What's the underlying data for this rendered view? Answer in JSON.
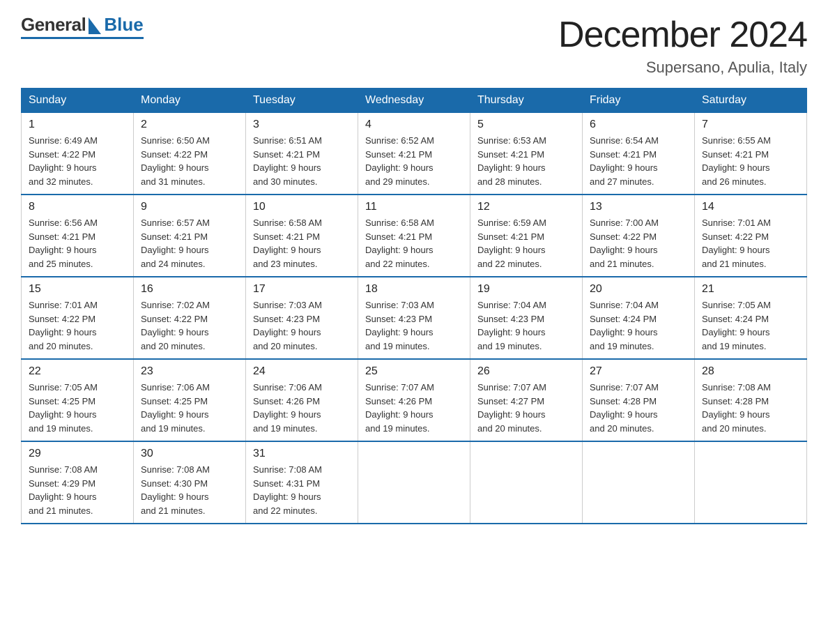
{
  "header": {
    "logo_general": "General",
    "logo_blue": "Blue",
    "month_title": "December 2024",
    "location": "Supersano, Apulia, Italy"
  },
  "days_of_week": [
    "Sunday",
    "Monday",
    "Tuesday",
    "Wednesday",
    "Thursday",
    "Friday",
    "Saturday"
  ],
  "weeks": [
    [
      {
        "day": "1",
        "sunrise": "6:49 AM",
        "sunset": "4:22 PM",
        "daylight": "9 hours and 32 minutes."
      },
      {
        "day": "2",
        "sunrise": "6:50 AM",
        "sunset": "4:22 PM",
        "daylight": "9 hours and 31 minutes."
      },
      {
        "day": "3",
        "sunrise": "6:51 AM",
        "sunset": "4:21 PM",
        "daylight": "9 hours and 30 minutes."
      },
      {
        "day": "4",
        "sunrise": "6:52 AM",
        "sunset": "4:21 PM",
        "daylight": "9 hours and 29 minutes."
      },
      {
        "day": "5",
        "sunrise": "6:53 AM",
        "sunset": "4:21 PM",
        "daylight": "9 hours and 28 minutes."
      },
      {
        "day": "6",
        "sunrise": "6:54 AM",
        "sunset": "4:21 PM",
        "daylight": "9 hours and 27 minutes."
      },
      {
        "day": "7",
        "sunrise": "6:55 AM",
        "sunset": "4:21 PM",
        "daylight": "9 hours and 26 minutes."
      }
    ],
    [
      {
        "day": "8",
        "sunrise": "6:56 AM",
        "sunset": "4:21 PM",
        "daylight": "9 hours and 25 minutes."
      },
      {
        "day": "9",
        "sunrise": "6:57 AM",
        "sunset": "4:21 PM",
        "daylight": "9 hours and 24 minutes."
      },
      {
        "day": "10",
        "sunrise": "6:58 AM",
        "sunset": "4:21 PM",
        "daylight": "9 hours and 23 minutes."
      },
      {
        "day": "11",
        "sunrise": "6:58 AM",
        "sunset": "4:21 PM",
        "daylight": "9 hours and 22 minutes."
      },
      {
        "day": "12",
        "sunrise": "6:59 AM",
        "sunset": "4:21 PM",
        "daylight": "9 hours and 22 minutes."
      },
      {
        "day": "13",
        "sunrise": "7:00 AM",
        "sunset": "4:22 PM",
        "daylight": "9 hours and 21 minutes."
      },
      {
        "day": "14",
        "sunrise": "7:01 AM",
        "sunset": "4:22 PM",
        "daylight": "9 hours and 21 minutes."
      }
    ],
    [
      {
        "day": "15",
        "sunrise": "7:01 AM",
        "sunset": "4:22 PM",
        "daylight": "9 hours and 20 minutes."
      },
      {
        "day": "16",
        "sunrise": "7:02 AM",
        "sunset": "4:22 PM",
        "daylight": "9 hours and 20 minutes."
      },
      {
        "day": "17",
        "sunrise": "7:03 AM",
        "sunset": "4:23 PM",
        "daylight": "9 hours and 20 minutes."
      },
      {
        "day": "18",
        "sunrise": "7:03 AM",
        "sunset": "4:23 PM",
        "daylight": "9 hours and 19 minutes."
      },
      {
        "day": "19",
        "sunrise": "7:04 AM",
        "sunset": "4:23 PM",
        "daylight": "9 hours and 19 minutes."
      },
      {
        "day": "20",
        "sunrise": "7:04 AM",
        "sunset": "4:24 PM",
        "daylight": "9 hours and 19 minutes."
      },
      {
        "day": "21",
        "sunrise": "7:05 AM",
        "sunset": "4:24 PM",
        "daylight": "9 hours and 19 minutes."
      }
    ],
    [
      {
        "day": "22",
        "sunrise": "7:05 AM",
        "sunset": "4:25 PM",
        "daylight": "9 hours and 19 minutes."
      },
      {
        "day": "23",
        "sunrise": "7:06 AM",
        "sunset": "4:25 PM",
        "daylight": "9 hours and 19 minutes."
      },
      {
        "day": "24",
        "sunrise": "7:06 AM",
        "sunset": "4:26 PM",
        "daylight": "9 hours and 19 minutes."
      },
      {
        "day": "25",
        "sunrise": "7:07 AM",
        "sunset": "4:26 PM",
        "daylight": "9 hours and 19 minutes."
      },
      {
        "day": "26",
        "sunrise": "7:07 AM",
        "sunset": "4:27 PM",
        "daylight": "9 hours and 20 minutes."
      },
      {
        "day": "27",
        "sunrise": "7:07 AM",
        "sunset": "4:28 PM",
        "daylight": "9 hours and 20 minutes."
      },
      {
        "day": "28",
        "sunrise": "7:08 AM",
        "sunset": "4:28 PM",
        "daylight": "9 hours and 20 minutes."
      }
    ],
    [
      {
        "day": "29",
        "sunrise": "7:08 AM",
        "sunset": "4:29 PM",
        "daylight": "9 hours and 21 minutes."
      },
      {
        "day": "30",
        "sunrise": "7:08 AM",
        "sunset": "4:30 PM",
        "daylight": "9 hours and 21 minutes."
      },
      {
        "day": "31",
        "sunrise": "7:08 AM",
        "sunset": "4:31 PM",
        "daylight": "9 hours and 22 minutes."
      },
      null,
      null,
      null,
      null
    ]
  ],
  "labels": {
    "sunrise": "Sunrise:",
    "sunset": "Sunset:",
    "daylight": "Daylight:"
  }
}
